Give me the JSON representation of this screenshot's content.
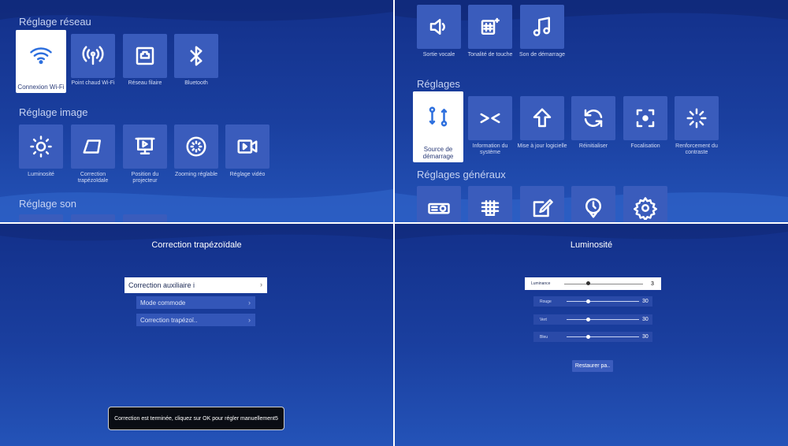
{
  "network": {
    "section_title": "Réglage réseau",
    "items": [
      "Connexion Wi-Fi",
      "Point chaud Wi-Fi",
      "Réseau filaire",
      "Bluetooth"
    ]
  },
  "image": {
    "section_title": "Réglage image",
    "items": [
      "Luminosité",
      "Correction trapézoïdale",
      "Position du projecteur",
      "Zooming réglable",
      "Réglage vidéo"
    ]
  },
  "sound": {
    "section_title": "Réglage son",
    "items": [
      "Sortie vocale",
      "Tonalité de touche",
      "Son de démarrage"
    ]
  },
  "settings": {
    "section_title": "Réglages",
    "items": [
      "Source de démarrage",
      "Information du système",
      "Mise à jour logicielle",
      "Réinitialiser",
      "Focalisation",
      "Renforcement du contraste"
    ]
  },
  "general": {
    "section_title": "Réglages généraux"
  },
  "keystone": {
    "title": "Correction trapézoïdale",
    "menu": [
      "Correction auxiliaire i",
      "Mode commode",
      "Correction trapézoï.."
    ],
    "toast": "Correction est terminée, cliquez sur OK pour régler manuellement5"
  },
  "brightness": {
    "title": "Luminosité",
    "sliders": [
      {
        "name": "Luminance",
        "value": "3",
        "frac": 0.3
      },
      {
        "name": "Rouge",
        "value": "30",
        "frac": 0.3
      },
      {
        "name": "Vert",
        "value": "30",
        "frac": 0.3
      },
      {
        "name": "Bleu",
        "value": "30",
        "frac": 0.3
      }
    ],
    "reset_label": "Restaurer pa.."
  },
  "colors": {
    "accent": "#2d6fde",
    "tile": "#3a5cbc",
    "bg": "#1a3f9f"
  }
}
